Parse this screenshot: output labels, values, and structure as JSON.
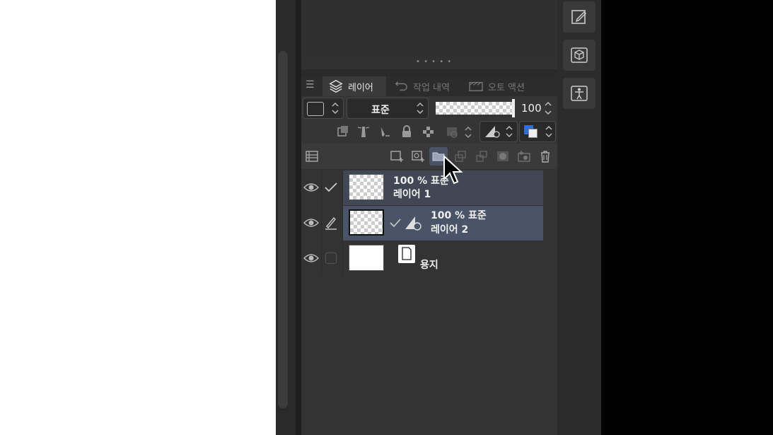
{
  "panel": {
    "tabs": [
      {
        "label": "레이어",
        "icon": "layers-icon",
        "active": true
      },
      {
        "label": "작업 내역",
        "icon": "history-icon",
        "active": false
      },
      {
        "label": "오토 액션",
        "icon": "auto-action-icon",
        "active": false
      }
    ],
    "blend_mode": "표준",
    "opacity_value": "100",
    "opacity_fraction": 1.0
  },
  "layers": [
    {
      "line1": "100 % 표준",
      "line2": "레이어 1",
      "visible": true,
      "state": "check",
      "selected": true
    },
    {
      "line1": "100 % 표준",
      "line2": "레이어 2",
      "visible": true,
      "state": "pen",
      "selected": true,
      "active": true
    },
    {
      "line1": "",
      "line2": "용지",
      "visible": true,
      "state": "empty",
      "selected": false
    }
  ],
  "colors": {
    "panel_bg": "#353535",
    "selected_row": "#414755",
    "active_row": "#4a5468",
    "accent_blue": "#2f6fd6"
  }
}
